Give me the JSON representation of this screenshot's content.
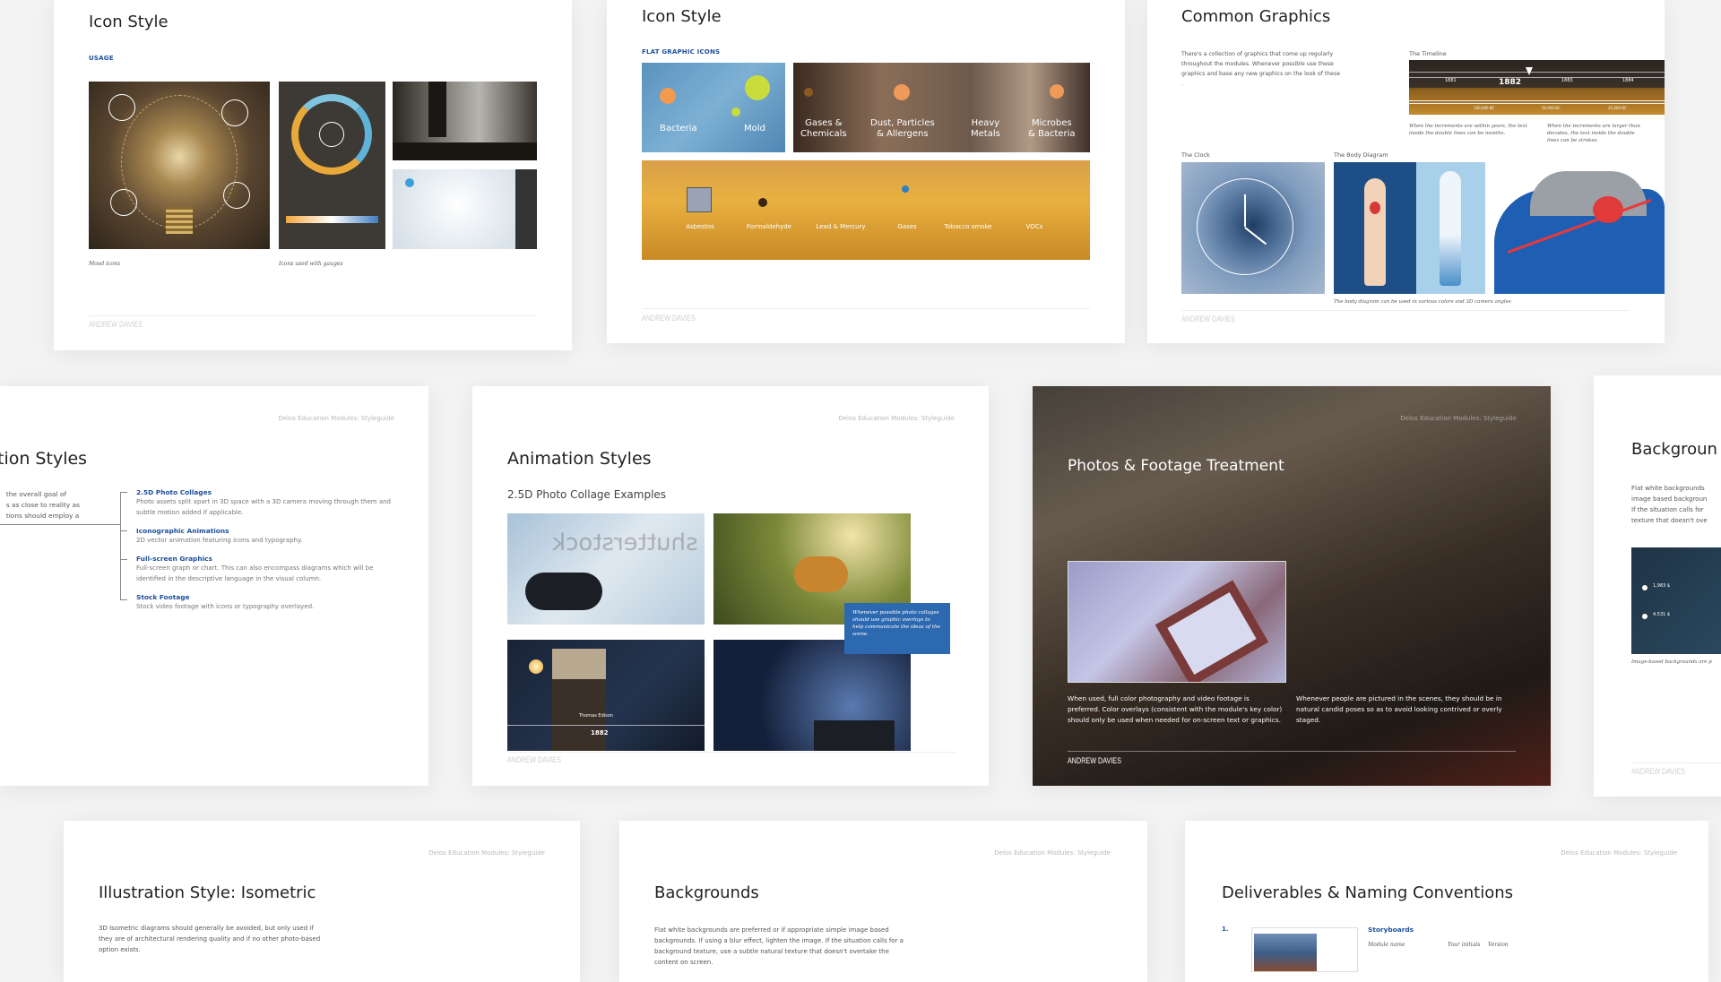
{
  "header_text": "Delos Education Modules: Styleguide",
  "author": "ANDREW DAVIES",
  "colors": {
    "accent_blue": "#1b4f9c",
    "background": "#f3f3f3"
  },
  "icon_style_usage": {
    "title": "Icon Style",
    "section": "USAGE",
    "captions": [
      "Mood icons",
      "Icons used with gauges"
    ]
  },
  "icon_style_flat": {
    "title": "Icon Style",
    "section": "FLAT GRAPHIC ICONS",
    "panel1": [
      "Bacteria",
      "Mold"
    ],
    "panel2": [
      "Gases &\nChemicals",
      "Dust, Particles\n& Allergens",
      "Heavy\nMetals",
      "Microbes\n& Bacteria"
    ],
    "panel3": [
      "Asbestos",
      "Formaldehyde",
      "Lead & Mercury",
      "Gases",
      "Tobacco smoke",
      "VOCs"
    ]
  },
  "common_graphics": {
    "title": "Common Graphics",
    "intro": "There's a collection  of graphics that come up regularly throughout the modules. Whenever possible use these graphics and base any new graphics on the look of these .",
    "timeline_label": "The Timeline",
    "timeline_years": [
      "1881",
      "1882",
      "1883",
      "1884"
    ],
    "timeline_bc": [
      "100,000 BC",
      "50,000 BC",
      "25,000 BC"
    ],
    "timeline_caption_1": "When the increments are within years, the text inside the double lines can be months.",
    "timeline_caption_2": "When the increments are larger than decades, the text inside the double lines can be strokes.",
    "clock_label": "The Clock",
    "body_label": "The Body Diagram",
    "body_caption": "The body diagram can be used in various colors and 3D camera angles"
  },
  "animation_styles_partial": {
    "title": "tion Styles",
    "intro_lines": [
      "the overall goal of",
      "s as close to reality as",
      "tions should employ a"
    ],
    "items": [
      {
        "heading": "2.5D Photo Collages",
        "desc": "Photo assets split apart in 3D space with a 3D camera moving through them and subtle motion added if applicable."
      },
      {
        "heading": "Iconographic Animations",
        "desc": "2D vector animation featuring icons and typography."
      },
      {
        "heading": "Full-screen Graphics",
        "desc": "Full-screen graph or chart. This can also encompass diagrams which will be identified in the descriptive language in the visual column."
      },
      {
        "heading": "Stock Footage",
        "desc": "Stock video footage with icons or typography overlayed."
      }
    ]
  },
  "animation_styles": {
    "title": "Animation Styles",
    "subtitle": "2.5D Photo Collage Examples",
    "overlay_note": "Whenever possible photo collages should use graphic overlays to help communicate the ideas of the scene.",
    "edison_name": "Thomas Edison",
    "edison_year": "1882",
    "watermark": "shutterstock"
  },
  "photos_footage": {
    "title": "Photos & Footage Treatment",
    "text_1": "When used, full color photography and video footage is preferred. Color overlays (consistent with the module's key color) should only be used when needed for on-screen text or graphics.",
    "text_2": "Whenever people are pictured in the scenes, they should be in natural candid poses so as to avoid looking contrived or overly staged."
  },
  "backgrounds_partial": {
    "title": "Backgroun",
    "lines": [
      "Flat white backgrounds",
      "image based backgroun",
      "If the situation calls for",
      "texture that doesn't ove"
    ],
    "values": [
      "1,983 $",
      "4,531 $"
    ],
    "caption": "Image-based backgrounds are p"
  },
  "isometric": {
    "title": "Illustration Style: Isometric",
    "text": "3D Isometric diagrams should generally be avoided, but only used if they are of architectural rendering quality and if no other photo-based option exists."
  },
  "backgrounds": {
    "title": "Backgrounds",
    "text": "Flat white backgrounds are preferred or if appropriate simple image based backgrounds. If using a blur effect, lighten the image. If the situation calls for a background texture, use a subtle natural texture that doesn't overtake the content on screen."
  },
  "deliverables": {
    "title": "Deliverables & Naming Conventions",
    "number": "1.",
    "heading": "Storyboards",
    "fields": [
      "Module name",
      "Your initials",
      "Version"
    ]
  }
}
